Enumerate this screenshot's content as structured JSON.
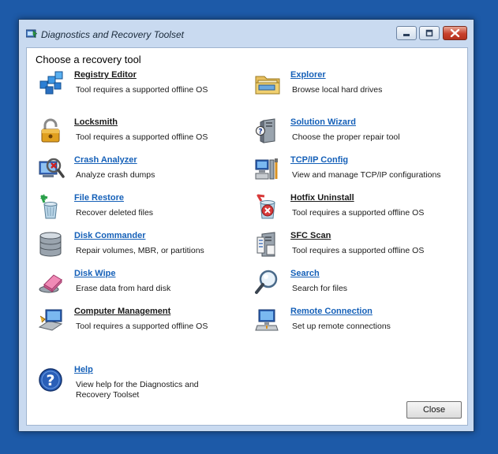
{
  "window": {
    "title": "Diagnostics and Recovery Toolset"
  },
  "heading": "Choose a recovery tool",
  "tools_left": [
    {
      "name": "Registry Editor",
      "desc": "Tool requires a supported offline OS",
      "icon": "registry-editor-icon"
    },
    {
      "name": "Locksmith",
      "desc": "Tool requires a supported offline OS",
      "icon": "padlock-icon"
    },
    {
      "name": "Crash Analyzer",
      "desc": "Analyze crash dumps",
      "icon": "crash-analyzer-icon"
    },
    {
      "name": "File Restore",
      "desc": "Recover deleted files",
      "icon": "recycle-bin-icon"
    },
    {
      "name": "Disk Commander",
      "desc": "Repair volumes, MBR, or partitions",
      "icon": "disk-stack-icon"
    },
    {
      "name": "Disk Wipe",
      "desc": "Erase data from hard disk",
      "icon": "eraser-icon"
    },
    {
      "name": "Computer Management",
      "desc": "Tool requires a supported offline OS",
      "icon": "computer-management-icon"
    }
  ],
  "tools_right": [
    {
      "name": "Explorer",
      "desc": "Browse local hard drives",
      "icon": "folder-icon"
    },
    {
      "name": "Solution Wizard",
      "desc": "Choose the proper repair tool",
      "icon": "solution-wizard-icon"
    },
    {
      "name": "TCP/IP Config",
      "desc": "View and manage TCP/IP configurations",
      "icon": "network-config-icon"
    },
    {
      "name": "Hotfix Uninstall",
      "desc": "Tool requires a supported offline OS",
      "icon": "hotfix-uninstall-icon"
    },
    {
      "name": "SFC Scan",
      "desc": "Tool requires a supported offline OS",
      "icon": "sfc-scan-icon"
    },
    {
      "name": "Search",
      "desc": "Search for files",
      "icon": "magnifier-icon"
    },
    {
      "name": "Remote Connection",
      "desc": "Set up remote connections",
      "icon": "remote-connection-icon"
    }
  ],
  "help": {
    "name": "Help",
    "desc": "View help for the Diagnostics and Recovery Toolset",
    "icon": "help-icon"
  },
  "close_label": "Close",
  "colors": {
    "desktop": "#1d5aa8",
    "link_blue": "#1560b8",
    "frame": "#c9daf0"
  }
}
